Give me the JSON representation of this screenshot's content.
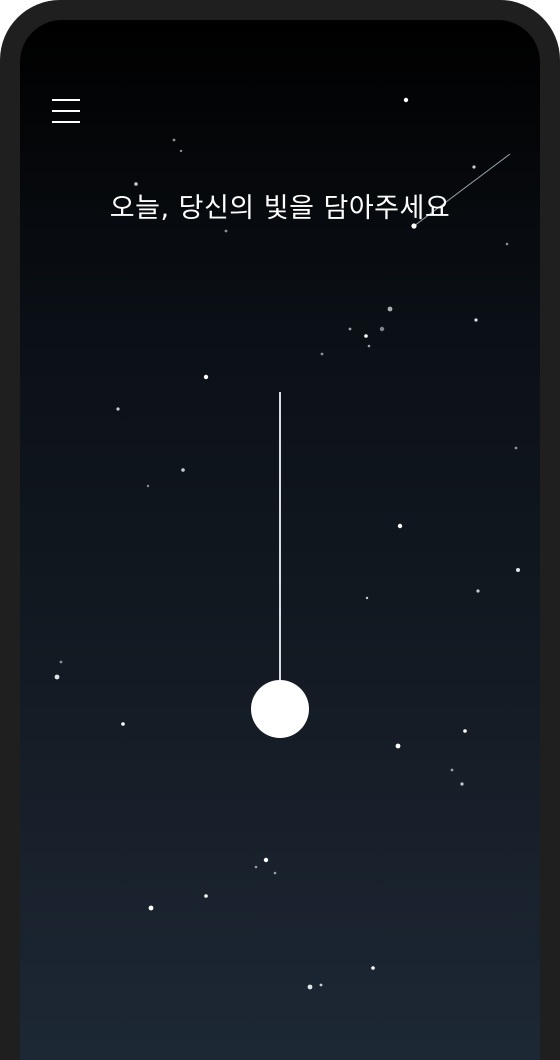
{
  "app": {
    "headline": "오늘, 당신의 빛을 담아주세요"
  },
  "icons": {
    "menu": "hamburger-menu-icon"
  },
  "colors": {
    "background_top": "#000000",
    "background_bottom": "#1d2835",
    "star": "#ffffff",
    "frame": "#1f1f1f"
  }
}
